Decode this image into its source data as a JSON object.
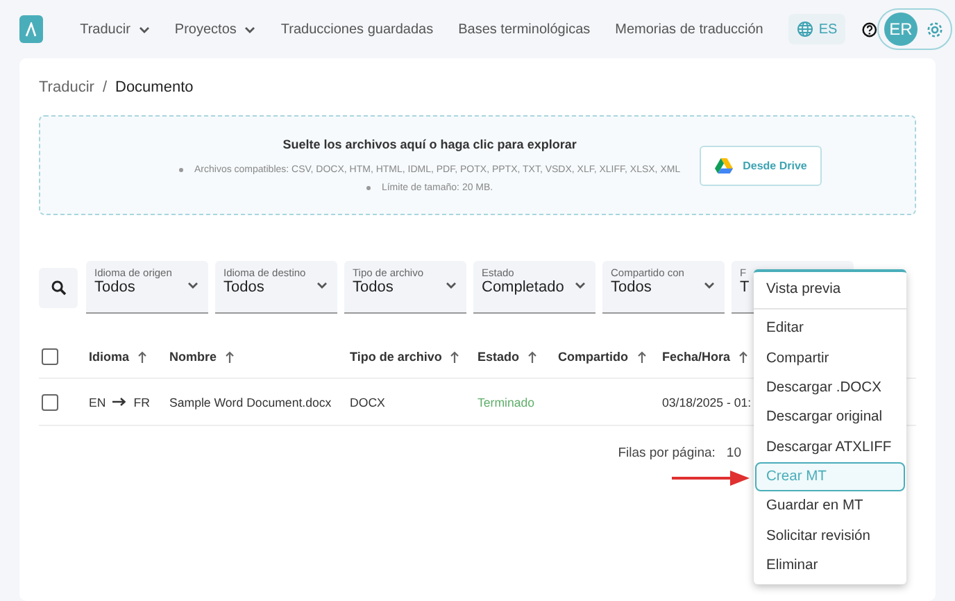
{
  "nav": {
    "items": [
      {
        "label": "Traducir",
        "dropdown": true
      },
      {
        "label": "Proyectos",
        "dropdown": true
      },
      {
        "label": "Traducciones guardadas",
        "dropdown": false
      },
      {
        "label": "Bases terminológicas",
        "dropdown": false
      },
      {
        "label": "Memorias de traducción",
        "dropdown": false
      }
    ],
    "language": "ES",
    "avatar": "ER"
  },
  "breadcrumb": {
    "items": [
      "Traducir",
      "Documento"
    ],
    "separator": "/"
  },
  "dropzone": {
    "title": "Suelte los archivos aquí o haga clic para explorar",
    "notes": [
      "Archivos compatibles: CSV, DOCX, HTM, HTML, IDML, PDF, POTX, PPTX, TXT, VSDX, XLF, XLIFF, XLSX, XML",
      "Límite de tamaño: 20 MB."
    ],
    "drive_button": "Desde Drive"
  },
  "filters": [
    {
      "label": "Idioma de origen",
      "value": "Todos"
    },
    {
      "label": "Idioma de destino",
      "value": "Todos"
    },
    {
      "label": "Tipo de archivo",
      "value": "Todos"
    },
    {
      "label": "Estado",
      "value": "Completado"
    },
    {
      "label": "Compartido con",
      "value": "Todos"
    },
    {
      "label": "F",
      "value": "T"
    }
  ],
  "table": {
    "select_all_checked": false,
    "columns": [
      "Idioma",
      "Nombre",
      "Tipo de archivo",
      "Estado",
      "Compartido",
      "Fecha/Hora"
    ],
    "rows": [
      {
        "checked": false,
        "source": "EN",
        "target": "FR",
        "name": "Sample Word Document.docx",
        "type": "DOCX",
        "status": "Terminado",
        "date": "03/18/2025 - 01:"
      }
    ]
  },
  "pagination": {
    "label": "Filas por página:",
    "value": "10"
  },
  "menu": {
    "items": [
      {
        "label": "Vista previa",
        "selected": false,
        "divider_after": true
      },
      {
        "label": "Editar",
        "selected": false,
        "divider_after": false
      },
      {
        "label": "Compartir",
        "selected": false,
        "divider_after": false
      },
      {
        "label": "Descargar .DOCX",
        "selected": false,
        "divider_after": false
      },
      {
        "label": "Descargar original",
        "selected": false,
        "divider_after": false
      },
      {
        "label": "Descargar ATXLIFF",
        "selected": false,
        "divider_after": false
      },
      {
        "label": "Crear MT",
        "selected": true,
        "divider_after": false
      },
      {
        "label": "Guardar en MT",
        "selected": false,
        "divider_after": false
      },
      {
        "label": "Solicitar revisión",
        "selected": false,
        "divider_after": false
      },
      {
        "label": "Eliminar",
        "selected": false,
        "divider_after": false
      }
    ]
  }
}
